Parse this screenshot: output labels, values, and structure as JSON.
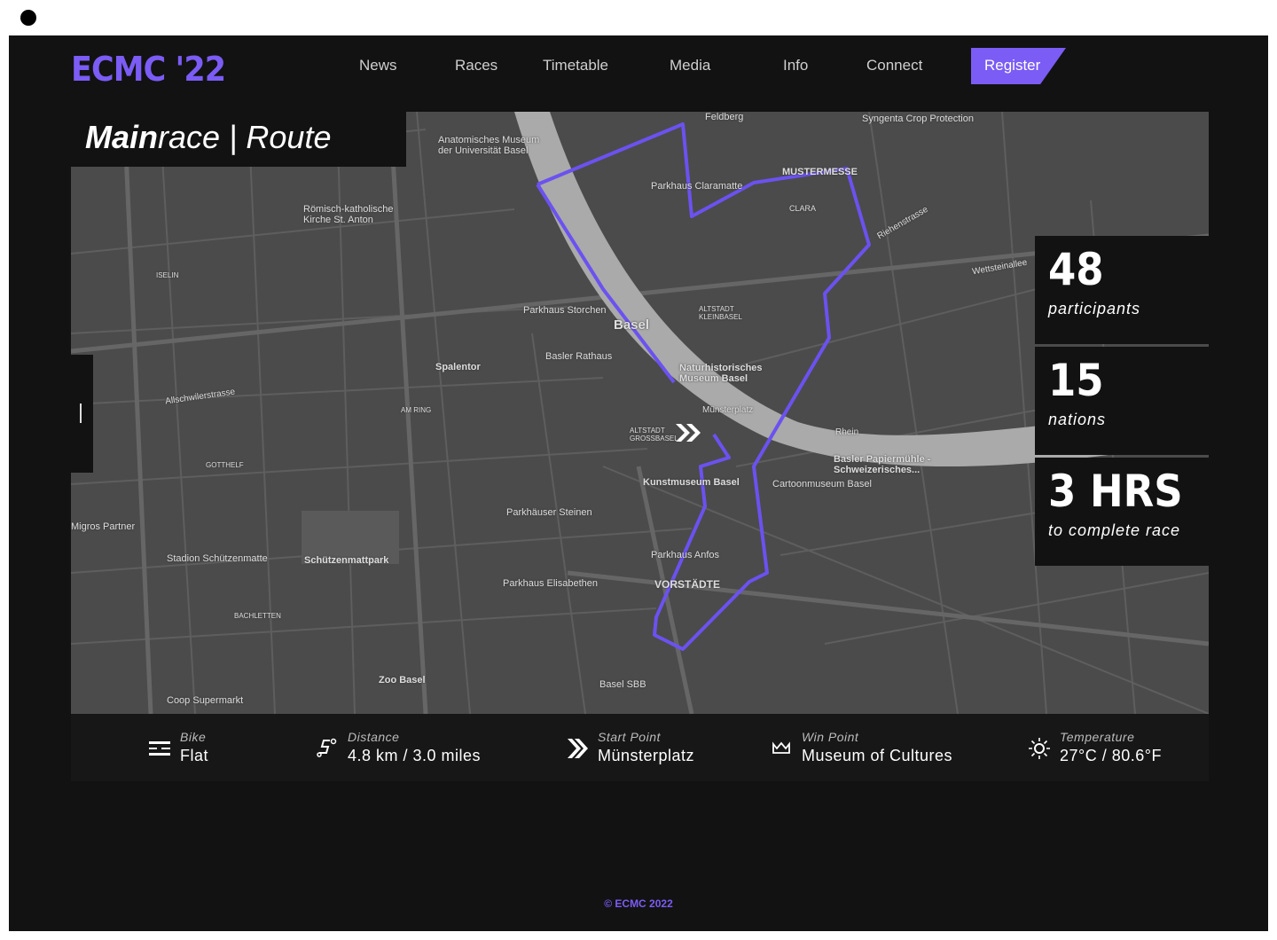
{
  "header": {
    "logo": "ECMC '22",
    "nav": [
      "News",
      "Races",
      "Timetable",
      "Media",
      "Info",
      "Connect"
    ],
    "register": "Register",
    "accent": "#7b5cf5"
  },
  "title": {
    "bold": "Main",
    "rest": "race | Route"
  },
  "map": {
    "labels": [
      "Anatomisches Museum der Universität Basel",
      "Syngenta Crop Protection",
      "Feldberg",
      "Parkhaus Claramatte",
      "MUSTERMESSE",
      "CLARA",
      "Römisch-katholische Kirche St. Anton",
      "Parkhaus Storchen",
      "Basel",
      "Basler Rathaus",
      "Spalentor",
      "Naturhistorisches Museum Basel",
      "Münsterplatz",
      "Rhein",
      "Basler Papiermühle - Schweizerisches...",
      "Kunstmuseum Basel",
      "Cartoonmuseum Basel",
      "Parkhäuser Steinen",
      "Stadion Schützenmatte",
      "Schützenmattpark",
      "Parkhaus Anfos",
      "Parkhaus Elisabethen",
      "VORSTÄDTE",
      "Zoo Basel",
      "Basel SBB",
      "Coop Supermarkt",
      "Migros Partner",
      "ALTSTADT GROSSBASEL",
      "ALTSTADT KLEINBASEL",
      "Wettsteinallee",
      "Riehenstrasse",
      "Allschwilerstrasse",
      "GOTTHELF",
      "BACHLETTEN",
      "ISELIN",
      "AM RING"
    ],
    "route_color": "#6b52f0"
  },
  "stats": [
    {
      "value": "48",
      "label": "participants"
    },
    {
      "value": "15",
      "label": "nations"
    },
    {
      "value": "3 HRS",
      "label": "to complete race"
    }
  ],
  "info": [
    {
      "icon": "bike-flat-icon",
      "key": "Bike",
      "value": "Flat"
    },
    {
      "icon": "distance-icon",
      "key": "Distance",
      "value": "4.8 km / 3.0 miles"
    },
    {
      "icon": "start-chevrons-icon",
      "key": "Start Point",
      "value": "Münsterplatz"
    },
    {
      "icon": "crown-icon",
      "key": "Win Point",
      "value": "Museum of Cultures"
    },
    {
      "icon": "sun-icon",
      "key": "Temperature",
      "value": "27°C / 80.6°F"
    }
  ],
  "footer": "© ECMC 2022"
}
